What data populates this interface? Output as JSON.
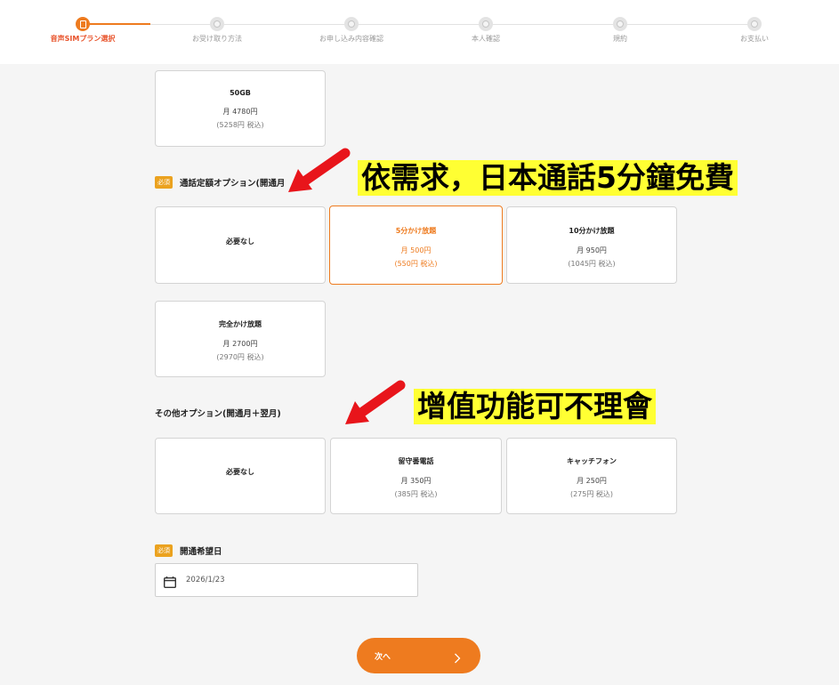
{
  "stepper": {
    "steps": [
      {
        "label": "音声SIMプラン選択",
        "active": true
      },
      {
        "label": "お受け取り方法",
        "active": false
      },
      {
        "label": "お申し込み内容確認",
        "active": false
      },
      {
        "label": "本人確認",
        "active": false
      },
      {
        "label": "規約",
        "active": false
      },
      {
        "label": "お支払い",
        "active": false
      }
    ]
  },
  "plan_top": {
    "title": "50GB",
    "price": "月 4780円",
    "tax": "(5258円 税込)"
  },
  "call_section": {
    "badge": "必須",
    "title": "通話定額オプション(開通月",
    "options": [
      {
        "title": "必要なし",
        "price": "",
        "tax": "",
        "selected": false
      },
      {
        "title": "5分かけ放題",
        "price": "月 500円",
        "tax": "(550円 税込)",
        "selected": true
      },
      {
        "title": "10分かけ放題",
        "price": "月 950円",
        "tax": "(1045円 税込)",
        "selected": false
      },
      {
        "title": "完全かけ放題",
        "price": "月 2700円",
        "tax": "(2970円 税込)",
        "selected": false
      }
    ]
  },
  "other_section": {
    "title": "その他オプション(開通月＋翌月)",
    "options": [
      {
        "title": "必要なし",
        "price": "",
        "tax": ""
      },
      {
        "title": "留守番電話",
        "price": "月 350円",
        "tax": "(385円 税込)"
      },
      {
        "title": "キャッチフォン",
        "price": "月 250円",
        "tax": "(275円 税込)"
      }
    ]
  },
  "date_section": {
    "badge": "必須",
    "title": "開通希望日",
    "value": "2026/1/23",
    "icon": "calendar-icon"
  },
  "next_button": {
    "label": "次へ"
  },
  "annotations": {
    "call": "依需求，日本通話5分鐘免費",
    "other": "增值功能可不理會"
  },
  "colors": {
    "accent": "#ee7b1f",
    "badge": "#eba21f",
    "highlight": "#ffff33",
    "arrow": "#e8151b"
  }
}
